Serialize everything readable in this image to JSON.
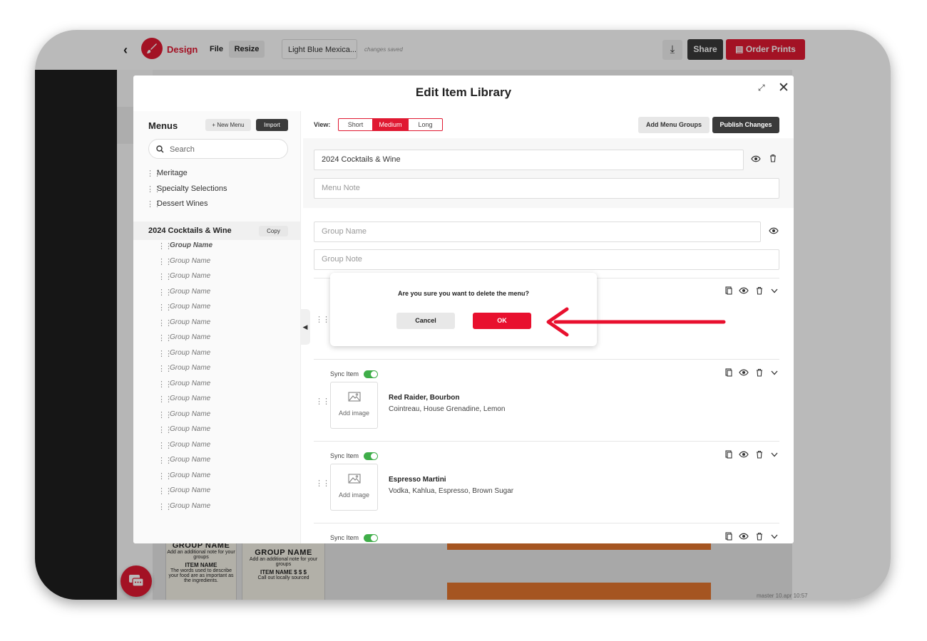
{
  "app": {
    "brand": "Design",
    "file_menu": "File",
    "resize": "Resize",
    "doc_title": "Light Blue Mexica...",
    "save_status": "changes saved",
    "share": "Share",
    "order_prints": "Order Prints",
    "version": "master 10.apr 10:57",
    "brand_color": "#e01932"
  },
  "modal": {
    "title": "Edit Item Library",
    "left": {
      "heading": "Menus",
      "new_menu": "+ New Menu",
      "import": "Import",
      "search_placeholder": "Search",
      "menus": [
        "Meritage",
        "Specialty Selections",
        "Dessert Wines"
      ],
      "active_menu": "2024 Cocktails & Wine",
      "copy": "Copy",
      "groups": [
        "Group Name",
        "Group Name",
        "Group Name",
        "Group Name",
        "Group Name",
        "Group Name",
        "Group Name",
        "Group Name",
        "Group Name",
        "Group Name",
        "Group Name",
        "Group Name",
        "Group Name",
        "Group Name",
        "Group Name",
        "Group Name",
        "Group Name",
        "Group Name"
      ]
    },
    "right": {
      "view_label": "View:",
      "views": [
        "Short",
        "Medium",
        "Long"
      ],
      "selected_view": "Medium",
      "add_menu_groups": "Add Menu Groups",
      "publish_changes": "Publish Changes",
      "menu_name": "2024 Cocktails & Wine",
      "menu_note_placeholder": "Menu Note",
      "group_name_placeholder": "Group Name",
      "group_note_placeholder": "Group Note",
      "sync_item": "Sync Item",
      "add_image": "Add image",
      "items": [
        {
          "name": "Red Raider, Bourbon",
          "desc": "Cointreau, House Grenadine, Lemon"
        },
        {
          "name": "Espresso Martini",
          "desc": "Vodka, Kahlua, Espresso, Brown Sugar"
        }
      ]
    }
  },
  "dialog": {
    "question": "Are you sure you want to delete the menu?",
    "cancel": "Cancel",
    "ok": "OK"
  },
  "thumbs": {
    "t1": {
      "group": "GROUP NAME",
      "note": "Add an additional note for your groups",
      "item": "ITEM NAME",
      "desc": "The words used to describe your food are as important as the ingredients."
    },
    "t2": {
      "group": "GROUP NAME",
      "note": "Add an additional note for your groups",
      "item": "ITEM NAME",
      "prices": "$ $ $",
      "desc": "Call out locally sourced"
    }
  }
}
